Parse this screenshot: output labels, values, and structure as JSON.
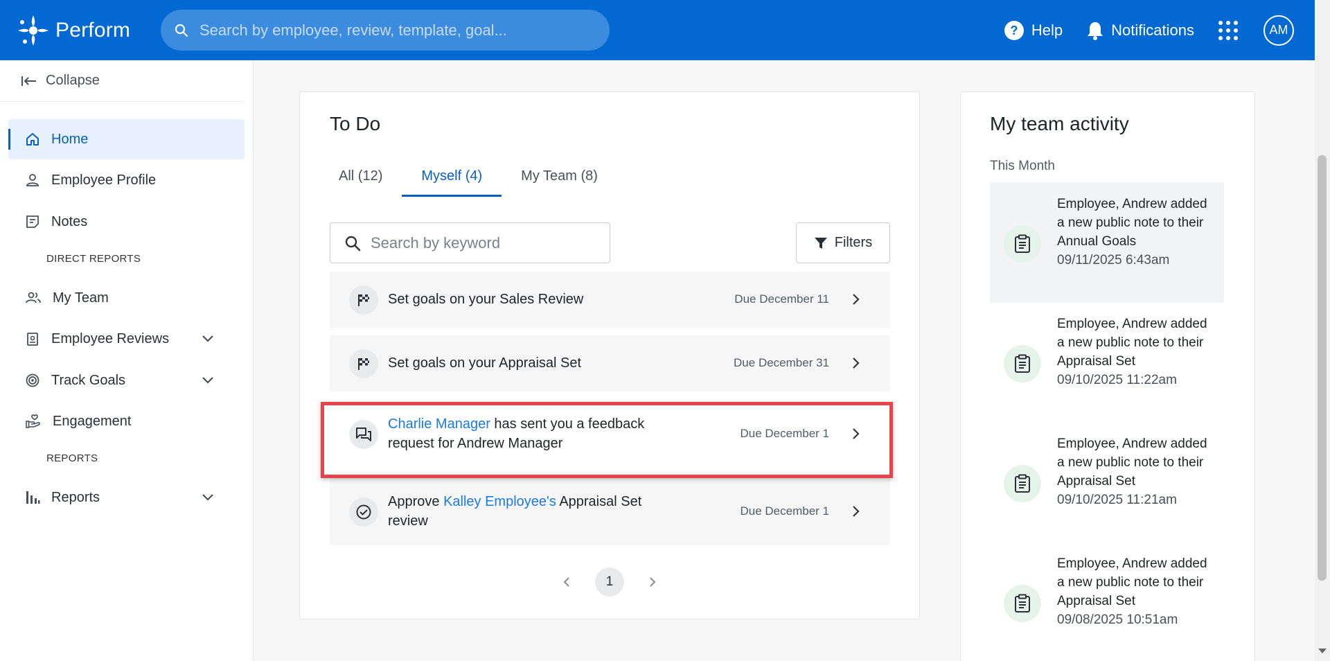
{
  "header": {
    "brand": "Perform",
    "search_placeholder": "Search by employee, review, template, goal...",
    "help_label": "Help",
    "notifications_label": "Notifications",
    "avatar_initials": "AM"
  },
  "sidebar": {
    "collapse_label": "Collapse",
    "items": {
      "home": "Home",
      "employee_profile": "Employee Profile",
      "notes": "Notes",
      "my_team": "My Team",
      "employee_reviews": "Employee Reviews",
      "track_goals": "Track Goals",
      "engagement": "Engagement",
      "reports": "Reports"
    },
    "sections": {
      "direct_reports": "DIRECT REPORTS",
      "reports": "REPORTS"
    }
  },
  "todo": {
    "title": "To Do",
    "tabs": [
      "All (12)",
      "Myself (4)",
      "My Team (8)"
    ],
    "active_tab": "Myself (4)",
    "search_placeholder": "Search by keyword",
    "filters_label": "Filters",
    "items": [
      {
        "text": "Set goals on your Sales Review",
        "due": "Due December 11",
        "icon": "flag-icon"
      },
      {
        "text": "Set goals on your Appraisal Set",
        "due": "Due December 31",
        "icon": "flag-icon"
      },
      {
        "link": "Charlie Manager",
        "text": " has sent you a feedback request for Andrew Manager",
        "due": "Due December 1",
        "icon": "feedback-icon"
      },
      {
        "prefix": "Approve ",
        "link": "Kalley Employee's",
        "text": " Appraisal Set review",
        "due": "Due December 1",
        "icon": "check-circle-icon"
      }
    ],
    "page": "1"
  },
  "activity": {
    "title": "My team activity",
    "subtitle": "This Month",
    "items": [
      {
        "text": "Employee, Andrew added a new public note to their Annual Goals",
        "date": "09/11/2025 6:43am"
      },
      {
        "text": "Employee, Andrew added a new public note to their Appraisal Set",
        "date": "09/10/2025 11:22am"
      },
      {
        "text": "Employee, Andrew added a new public note to their Appraisal Set",
        "date": "09/10/2025 11:21am"
      },
      {
        "text": "Employee, Andrew added a new public note to their Appraisal Set",
        "date": "09/08/2025 10:51am"
      }
    ]
  },
  "colors": {
    "brand_blue": "#0268d2",
    "link_blue": "#1a7adf",
    "highlight_red": "#e8434b"
  }
}
